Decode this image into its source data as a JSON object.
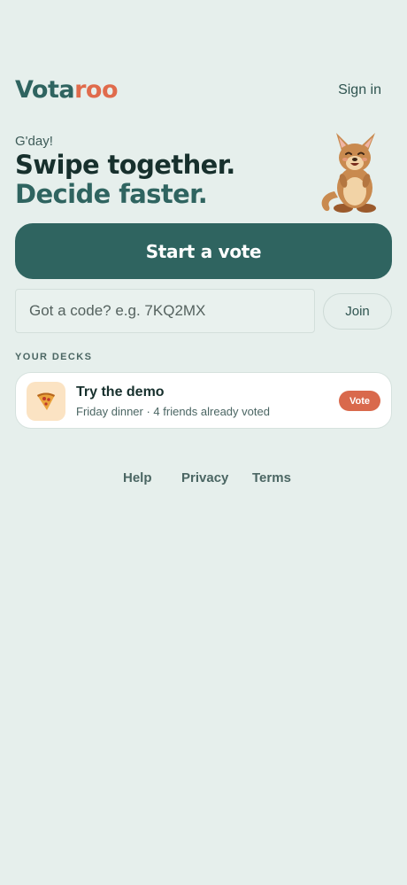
{
  "header": {
    "logo_part1": "Vota",
    "logo_part2": "roo",
    "sign_in": "Sign in"
  },
  "hero": {
    "greeting": "G'day!",
    "headline_part1": "Swipe together.",
    "headline_part2": "Decide faster.",
    "mascot": "kangaroo-mascot"
  },
  "actions": {
    "start_vote": "Start a vote",
    "code_placeholder": "Got a code? e.g. 7KQ2MX",
    "code_value": "",
    "join": "Join"
  },
  "decks": {
    "section_label": "YOUR DECKS",
    "items": [
      {
        "icon": "pizza-icon",
        "title": "Try the demo",
        "subtitle": "Friday dinner · 4 friends already voted",
        "action": "Vote"
      }
    ]
  },
  "footer": {
    "links": [
      "Help",
      "Privacy",
      "Terms"
    ]
  },
  "colors": {
    "background": "#e6efec",
    "brand_teal": "#2f6460",
    "brand_orange": "#e06b4c",
    "vote_pill": "#d9694c"
  }
}
